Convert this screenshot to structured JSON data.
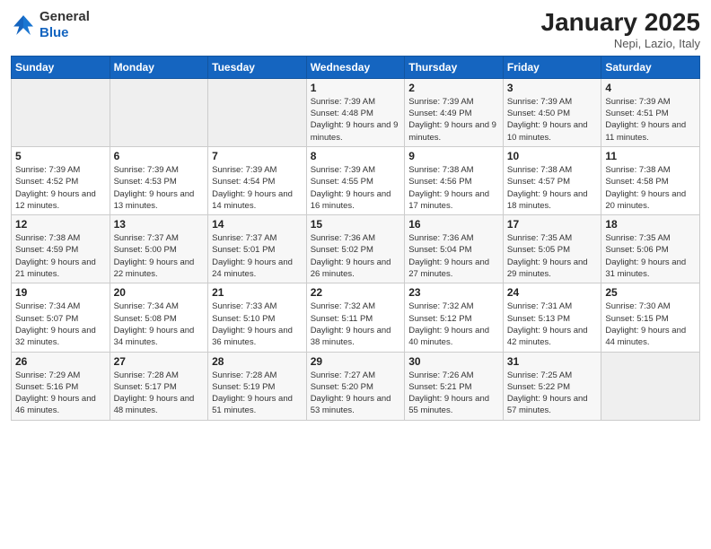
{
  "logo": {
    "general": "General",
    "blue": "Blue"
  },
  "title": "January 2025",
  "subtitle": "Nepi, Lazio, Italy",
  "days_of_week": [
    "Sunday",
    "Monday",
    "Tuesday",
    "Wednesday",
    "Thursday",
    "Friday",
    "Saturday"
  ],
  "weeks": [
    [
      {
        "day": null,
        "sunrise": null,
        "sunset": null,
        "daylight": null
      },
      {
        "day": null,
        "sunrise": null,
        "sunset": null,
        "daylight": null
      },
      {
        "day": null,
        "sunrise": null,
        "sunset": null,
        "daylight": null
      },
      {
        "day": "1",
        "sunrise": "7:39 AM",
        "sunset": "4:48 PM",
        "daylight": "9 hours and 9 minutes."
      },
      {
        "day": "2",
        "sunrise": "7:39 AM",
        "sunset": "4:49 PM",
        "daylight": "9 hours and 9 minutes."
      },
      {
        "day": "3",
        "sunrise": "7:39 AM",
        "sunset": "4:50 PM",
        "daylight": "9 hours and 10 minutes."
      },
      {
        "day": "4",
        "sunrise": "7:39 AM",
        "sunset": "4:51 PM",
        "daylight": "9 hours and 11 minutes."
      }
    ],
    [
      {
        "day": "5",
        "sunrise": "7:39 AM",
        "sunset": "4:52 PM",
        "daylight": "9 hours and 12 minutes."
      },
      {
        "day": "6",
        "sunrise": "7:39 AM",
        "sunset": "4:53 PM",
        "daylight": "9 hours and 13 minutes."
      },
      {
        "day": "7",
        "sunrise": "7:39 AM",
        "sunset": "4:54 PM",
        "daylight": "9 hours and 14 minutes."
      },
      {
        "day": "8",
        "sunrise": "7:39 AM",
        "sunset": "4:55 PM",
        "daylight": "9 hours and 16 minutes."
      },
      {
        "day": "9",
        "sunrise": "7:38 AM",
        "sunset": "4:56 PM",
        "daylight": "9 hours and 17 minutes."
      },
      {
        "day": "10",
        "sunrise": "7:38 AM",
        "sunset": "4:57 PM",
        "daylight": "9 hours and 18 minutes."
      },
      {
        "day": "11",
        "sunrise": "7:38 AM",
        "sunset": "4:58 PM",
        "daylight": "9 hours and 20 minutes."
      }
    ],
    [
      {
        "day": "12",
        "sunrise": "7:38 AM",
        "sunset": "4:59 PM",
        "daylight": "9 hours and 21 minutes."
      },
      {
        "day": "13",
        "sunrise": "7:37 AM",
        "sunset": "5:00 PM",
        "daylight": "9 hours and 22 minutes."
      },
      {
        "day": "14",
        "sunrise": "7:37 AM",
        "sunset": "5:01 PM",
        "daylight": "9 hours and 24 minutes."
      },
      {
        "day": "15",
        "sunrise": "7:36 AM",
        "sunset": "5:02 PM",
        "daylight": "9 hours and 26 minutes."
      },
      {
        "day": "16",
        "sunrise": "7:36 AM",
        "sunset": "5:04 PM",
        "daylight": "9 hours and 27 minutes."
      },
      {
        "day": "17",
        "sunrise": "7:35 AM",
        "sunset": "5:05 PM",
        "daylight": "9 hours and 29 minutes."
      },
      {
        "day": "18",
        "sunrise": "7:35 AM",
        "sunset": "5:06 PM",
        "daylight": "9 hours and 31 minutes."
      }
    ],
    [
      {
        "day": "19",
        "sunrise": "7:34 AM",
        "sunset": "5:07 PM",
        "daylight": "9 hours and 32 minutes."
      },
      {
        "day": "20",
        "sunrise": "7:34 AM",
        "sunset": "5:08 PM",
        "daylight": "9 hours and 34 minutes."
      },
      {
        "day": "21",
        "sunrise": "7:33 AM",
        "sunset": "5:10 PM",
        "daylight": "9 hours and 36 minutes."
      },
      {
        "day": "22",
        "sunrise": "7:32 AM",
        "sunset": "5:11 PM",
        "daylight": "9 hours and 38 minutes."
      },
      {
        "day": "23",
        "sunrise": "7:32 AM",
        "sunset": "5:12 PM",
        "daylight": "9 hours and 40 minutes."
      },
      {
        "day": "24",
        "sunrise": "7:31 AM",
        "sunset": "5:13 PM",
        "daylight": "9 hours and 42 minutes."
      },
      {
        "day": "25",
        "sunrise": "7:30 AM",
        "sunset": "5:15 PM",
        "daylight": "9 hours and 44 minutes."
      }
    ],
    [
      {
        "day": "26",
        "sunrise": "7:29 AM",
        "sunset": "5:16 PM",
        "daylight": "9 hours and 46 minutes."
      },
      {
        "day": "27",
        "sunrise": "7:28 AM",
        "sunset": "5:17 PM",
        "daylight": "9 hours and 48 minutes."
      },
      {
        "day": "28",
        "sunrise": "7:28 AM",
        "sunset": "5:19 PM",
        "daylight": "9 hours and 51 minutes."
      },
      {
        "day": "29",
        "sunrise": "7:27 AM",
        "sunset": "5:20 PM",
        "daylight": "9 hours and 53 minutes."
      },
      {
        "day": "30",
        "sunrise": "7:26 AM",
        "sunset": "5:21 PM",
        "daylight": "9 hours and 55 minutes."
      },
      {
        "day": "31",
        "sunrise": "7:25 AM",
        "sunset": "5:22 PM",
        "daylight": "9 hours and 57 minutes."
      },
      {
        "day": null,
        "sunrise": null,
        "sunset": null,
        "daylight": null
      }
    ]
  ],
  "labels": {
    "sunrise": "Sunrise:",
    "sunset": "Sunset:",
    "daylight": "Daylight:"
  }
}
